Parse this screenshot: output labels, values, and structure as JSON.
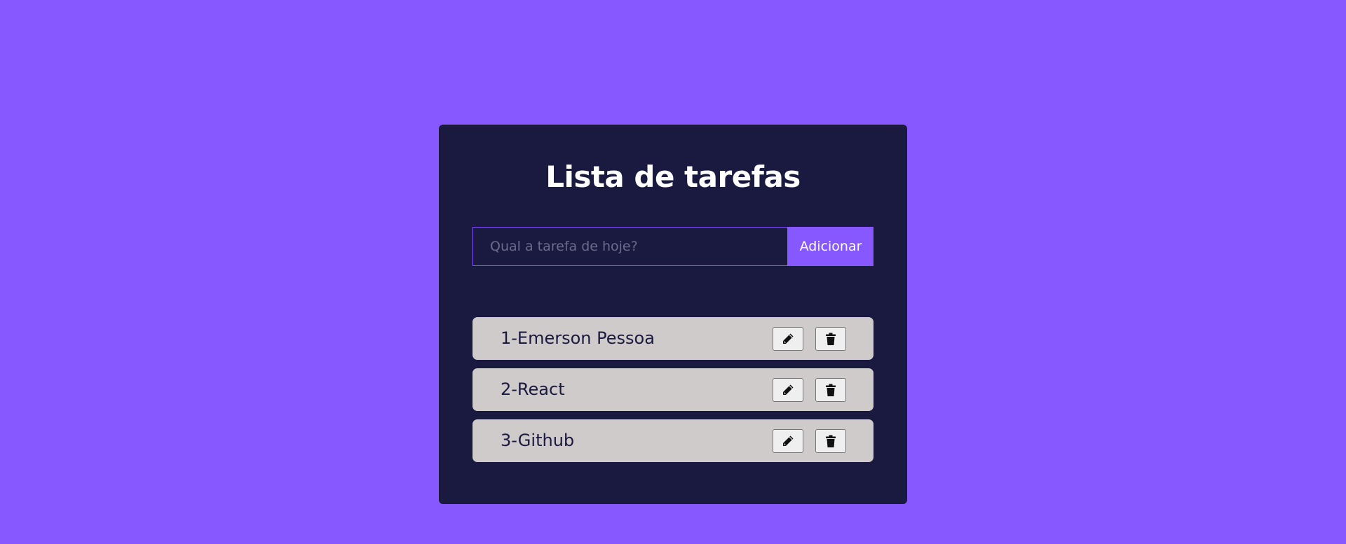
{
  "header": {
    "title": "Lista de tarefas"
  },
  "form": {
    "placeholder": "Qual a tarefa de hoje?",
    "value": "",
    "add_label": "Adicionar"
  },
  "tasks": [
    {
      "label": "1-Emerson Pessoa",
      "edit_icon": "pencil-icon",
      "delete_icon": "trash-icon"
    },
    {
      "label": "2-React",
      "edit_icon": "pencil-icon",
      "delete_icon": "trash-icon"
    },
    {
      "label": "3-Github",
      "edit_icon": "pencil-icon",
      "delete_icon": "trash-icon"
    }
  ],
  "colors": {
    "background": "#8758ff",
    "card": "#1a1a40",
    "accent": "#8758ff",
    "task_row": "#d0cbcb",
    "text_dark": "#1a1a40",
    "text_light": "#ffffff"
  }
}
